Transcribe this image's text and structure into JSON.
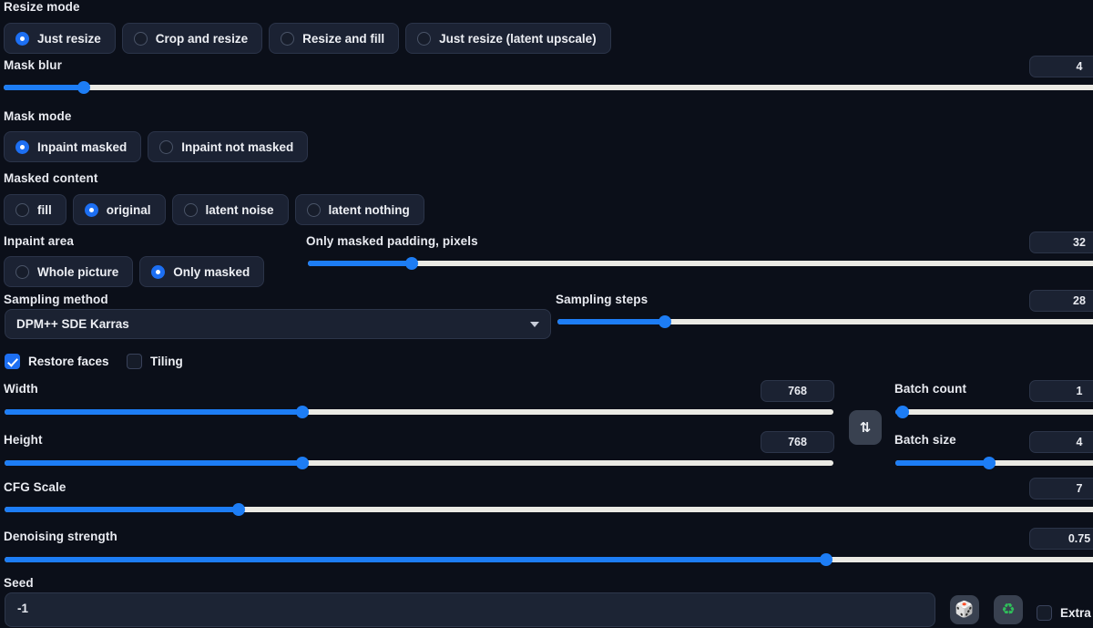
{
  "sections": {
    "resize_mode": {
      "label": "Resize mode",
      "options": [
        {
          "label": "Just resize",
          "selected": true
        },
        {
          "label": "Crop and resize",
          "selected": false
        },
        {
          "label": "Resize and fill",
          "selected": false
        },
        {
          "label": "Just resize (latent upscale)",
          "selected": false
        }
      ]
    },
    "mask_blur": {
      "label": "Mask blur",
      "value": "4"
    },
    "mask_mode": {
      "label": "Mask mode",
      "options": [
        {
          "label": "Inpaint masked",
          "selected": true
        },
        {
          "label": "Inpaint not masked",
          "selected": false
        }
      ]
    },
    "masked_content": {
      "label": "Masked content",
      "options": [
        {
          "label": "fill",
          "selected": false
        },
        {
          "label": "original",
          "selected": true
        },
        {
          "label": "latent noise",
          "selected": false
        },
        {
          "label": "latent nothing",
          "selected": false
        }
      ]
    },
    "inpaint_area": {
      "label": "Inpaint area",
      "options": [
        {
          "label": "Whole picture",
          "selected": false
        },
        {
          "label": "Only masked",
          "selected": true
        }
      ]
    },
    "only_masked_padding": {
      "label": "Only masked padding, pixels",
      "value": "32"
    },
    "sampling_method": {
      "label": "Sampling method",
      "value": "DPM++ SDE Karras"
    },
    "sampling_steps": {
      "label": "Sampling steps",
      "value": "28"
    },
    "restore_faces": {
      "label": "Restore faces",
      "checked": true
    },
    "tiling": {
      "label": "Tiling",
      "checked": false
    },
    "width": {
      "label": "Width",
      "value": "768"
    },
    "height": {
      "label": "Height",
      "value": "768"
    },
    "swap_button": {
      "glyph": "⇅"
    },
    "batch_count": {
      "label": "Batch count",
      "value": "1"
    },
    "batch_size": {
      "label": "Batch size",
      "value": "4"
    },
    "cfg_scale": {
      "label": "CFG Scale",
      "value": "7"
    },
    "denoising_strength": {
      "label": "Denoising strength",
      "value": "0.75"
    },
    "seed": {
      "label": "Seed",
      "value": "-1"
    },
    "seed_random_button": {
      "glyph": "🎲"
    },
    "seed_recycle_button": {
      "glyph": "♻"
    },
    "extra": {
      "label": "Extra",
      "checked": false
    }
  },
  "colors": {
    "background": "#0b0f19",
    "accent": "#1d7df5",
    "track": "#ebeae4",
    "surface": "#1b2232",
    "recycle_green": "#2fbf5a"
  }
}
